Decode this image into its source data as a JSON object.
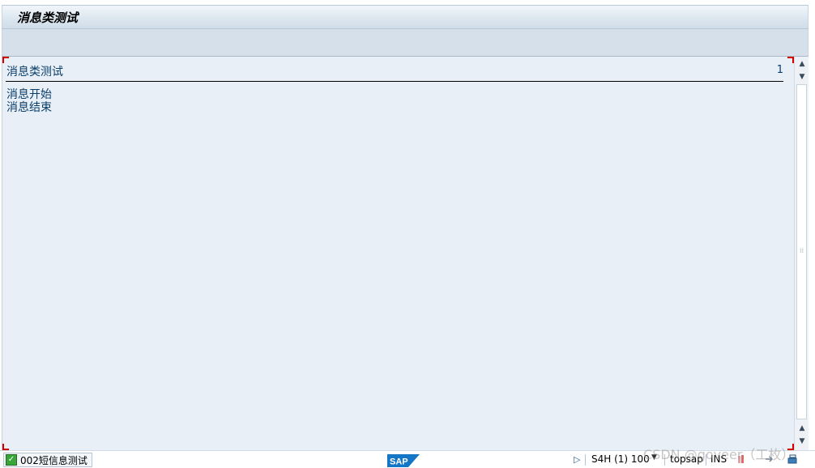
{
  "window": {
    "title": "消息类测试"
  },
  "list": {
    "header_title": "消息类测试",
    "page_number": "1",
    "lines": [
      "消息开始",
      "消息结束"
    ]
  },
  "statusbar": {
    "message": "002短信息测试",
    "system": "S4H (1) 100",
    "server": "topsap",
    "mode": "INS",
    "logo_text": "SAP"
  },
  "watermark": "CSDN @goveer（工枚）",
  "colors": {
    "text_blue": "#0a3e6b",
    "content_bg": "#e8eff6",
    "toolbar_bg": "#d6e0ea",
    "corner_red": "#d40000",
    "sap_blue": "#1476c6"
  }
}
